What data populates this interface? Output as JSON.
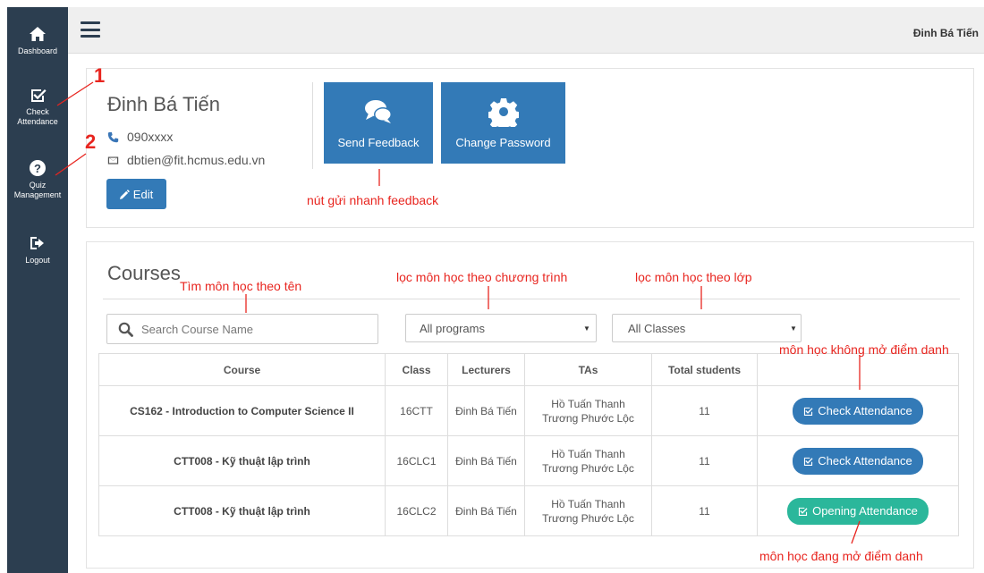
{
  "sidebar": {
    "items": [
      {
        "label": "Dashboard",
        "icon": "home-icon"
      },
      {
        "label": "Check Attendance",
        "icon": "checkbox-icon"
      },
      {
        "label": "Quiz Management",
        "icon": "question-circle-icon"
      },
      {
        "label": "Logout",
        "icon": "sign-out-icon"
      }
    ],
    "bg_color": "#2c3e50"
  },
  "topbar": {
    "user_name": "Đinh Bá Tiến"
  },
  "profile": {
    "name": "Đinh Bá Tiến",
    "phone": "090xxxx",
    "email": "dbtien@fit.hcmus.edu.vn",
    "edit_label": "Edit",
    "send_feedback_label": "Send Feedback",
    "change_password_label": "Change Password"
  },
  "courses": {
    "title": "Courses",
    "search_placeholder": "Search Course Name",
    "program_filter": "All programs",
    "class_filter": "All Classes",
    "columns": [
      "Course",
      "Class",
      "Lecturers",
      "TAs",
      "Total students",
      ""
    ],
    "rows": [
      {
        "course": "CS162 - Introduction to Computer Science II",
        "class": "16CTT",
        "lecturer": "Đinh Bá Tiến",
        "ta1": "Hồ Tuấn Thanh",
        "ta2": "Trương Phước Lộc",
        "total": "11",
        "action": "Check Attendance",
        "action_color": "#337ab7"
      },
      {
        "course": "CTT008 - Kỹ thuật lập trình",
        "class": "16CLC1",
        "lecturer": "Đinh Bá Tiến",
        "ta1": "Hồ Tuấn Thanh",
        "ta2": "Trương Phước Lộc",
        "total": "11",
        "action": "Check Attendance",
        "action_color": "#337ab7"
      },
      {
        "course": "CTT008 - Kỹ thuật lập trình",
        "class": "16CLC2",
        "lecturer": "Đinh Bá Tiến",
        "ta1": "Hồ Tuấn Thanh",
        "ta2": "Trương Phước Lộc",
        "total": "11",
        "action": "Opening Attendance",
        "action_color": "#2bb79b"
      }
    ]
  },
  "annotations": {
    "num1": "1",
    "num2": "2",
    "feedback_note": "nút gửi nhanh feedback",
    "search_note": "Tìm môn học theo tên",
    "program_note": "lọc môn học theo chương trình",
    "class_note": "lọc môn học theo lớp",
    "not_open_note": "môn học không mở điểm danh",
    "open_note": "môn học đang mở điểm danh",
    "color": "#e8251f"
  }
}
